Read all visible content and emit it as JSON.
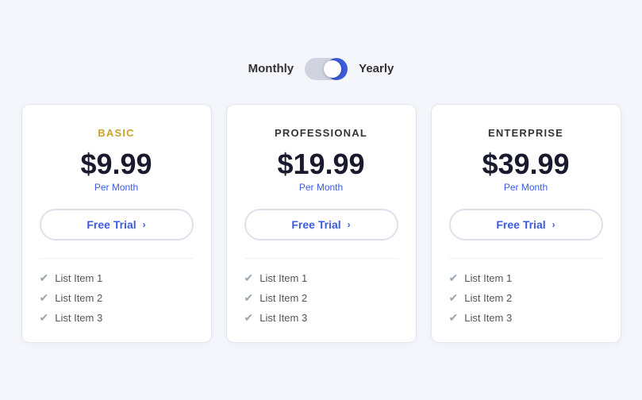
{
  "toggle": {
    "left_label": "Monthly",
    "right_label": "Yearly",
    "state": "yearly"
  },
  "plans": [
    {
      "id": "basic",
      "name": "BASIC",
      "name_color": "gold",
      "price": "$9.99",
      "period": "Per Month",
      "trial_btn": "Free Trial",
      "features": [
        "List Item 1",
        "List Item 2",
        "List Item 3"
      ]
    },
    {
      "id": "professional",
      "name": "PROFESSIONAL",
      "name_color": "dark",
      "price": "$19.99",
      "period": "Per Month",
      "trial_btn": "Free Trial",
      "features": [
        "List Item 1",
        "List Item 2",
        "List Item 3"
      ]
    },
    {
      "id": "enterprise",
      "name": "ENTERPRISE",
      "name_color": "dark",
      "price": "$39.99",
      "period": "Per Month",
      "trial_btn": "Free Trial",
      "features": [
        "List Item 1",
        "List Item 2",
        "List Item 3"
      ]
    }
  ],
  "icons": {
    "chevron": "›",
    "check": "✔"
  }
}
